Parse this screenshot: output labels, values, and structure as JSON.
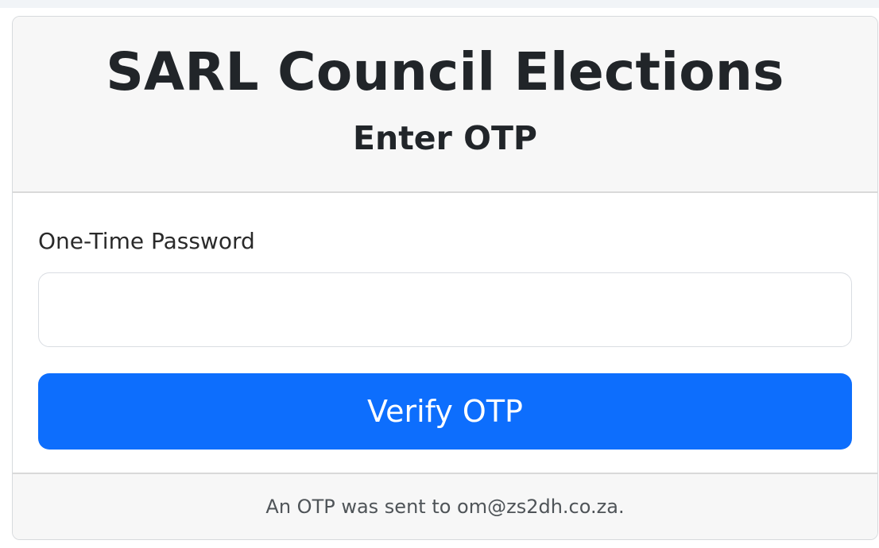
{
  "header": {
    "title": "SARL Council Elections",
    "subtitle": "Enter OTP"
  },
  "form": {
    "label": "One-Time Password",
    "input_value": "",
    "input_placeholder": "",
    "button_label": "Verify OTP"
  },
  "footer": {
    "message": "An OTP was sent to om@zs2dh.co.za."
  },
  "colors": {
    "primary_button": "#0d6efd",
    "header_bg": "#f7f7f7",
    "footer_bg": "#f7f7f7"
  }
}
